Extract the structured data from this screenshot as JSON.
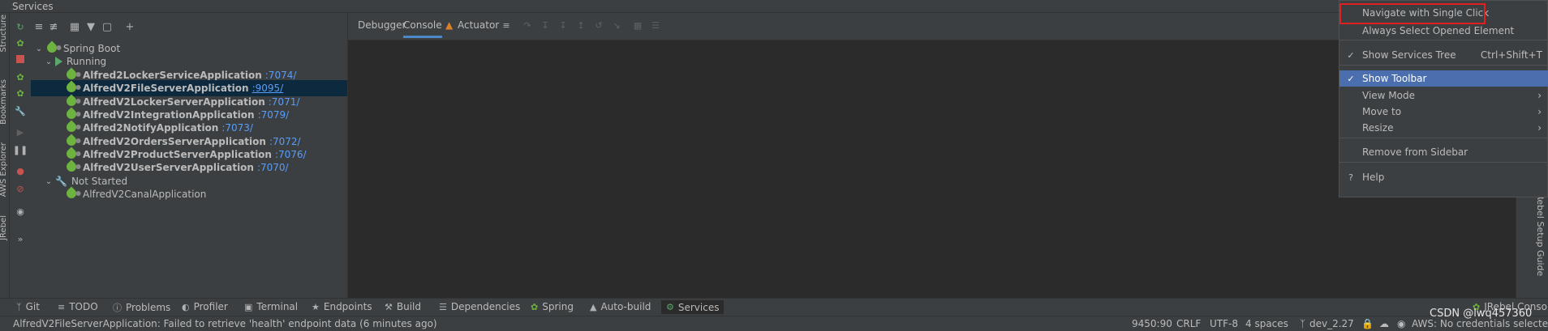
{
  "window": {
    "title": "Services"
  },
  "left_strip": {
    "labels": [
      "Structure",
      "Bookmarks",
      "AWS Explorer",
      "JRebel"
    ]
  },
  "tree": {
    "root": "Spring Boot",
    "running_group": "Running",
    "apps_running": [
      {
        "name": "Alfred2LockerServiceApplication",
        "port": ":7074/"
      },
      {
        "name": "AlfredV2FileServerApplication",
        "port": ":9095/"
      },
      {
        "name": "AlfredV2LockerServerApplication",
        "port": ":7071/"
      },
      {
        "name": "AlfredV2IntegrationApplication",
        "port": ":7079/"
      },
      {
        "name": "Alfred2NotifyApplication",
        "port": ":7073/"
      },
      {
        "name": "AlfredV2OrdersServerApplication",
        "port": ":7072/"
      },
      {
        "name": "AlfredV2ProductServerApplication",
        "port": ":7076/"
      },
      {
        "name": "AlfredV2UserServerApplication",
        "port": ":7070/"
      }
    ],
    "not_started_group": "Not Started",
    "apps_not_started": [
      {
        "name": "AlfredV2CanalApplication"
      }
    ]
  },
  "console_tabs": {
    "debugger": "Debugger",
    "console": "Console",
    "actuator": "Actuator"
  },
  "context_menu": {
    "items": [
      {
        "label": "Navigate with Single Click",
        "checked": false
      },
      {
        "label": "Always Select Opened Element",
        "checked": false
      },
      {
        "label": "Show Services Tree",
        "checked": true,
        "shortcut": "Ctrl+Shift+T"
      },
      {
        "label": "Show Toolbar",
        "checked": true
      },
      {
        "label": "View Mode",
        "submenu": true
      },
      {
        "label": "Move to",
        "submenu": true
      },
      {
        "label": "Resize",
        "submenu": true
      },
      {
        "label": "Remove from Sidebar"
      },
      {
        "label": "Help",
        "icon": "?"
      }
    ]
  },
  "right_strip": {
    "label": "JRebel Setup Guide"
  },
  "bottom_bar": {
    "items": [
      "Git",
      "TODO",
      "Problems",
      "Profiler",
      "Terminal",
      "Endpoints",
      "Build",
      "Dependencies",
      "Spring",
      "Auto-build",
      "Services"
    ],
    "jrebel_console": "JRebel Console"
  },
  "status_bar": {
    "message": "AlfredV2FileServerApplication: Failed to retrieve 'health' endpoint data (6 minutes ago)",
    "position": "9450:90",
    "line_sep": "CRLF",
    "encoding": "UTF-8",
    "indent": "4 spaces",
    "branch": "dev_2.27",
    "aws": "AWS: No credentials selected"
  },
  "watermark": "CSDN @lwq457360",
  "colors": {
    "accent": "#4b6eaf",
    "link": "#589df6",
    "highlight_box": "#e02020",
    "spring": "#6db33f",
    "run": "#59a869"
  }
}
